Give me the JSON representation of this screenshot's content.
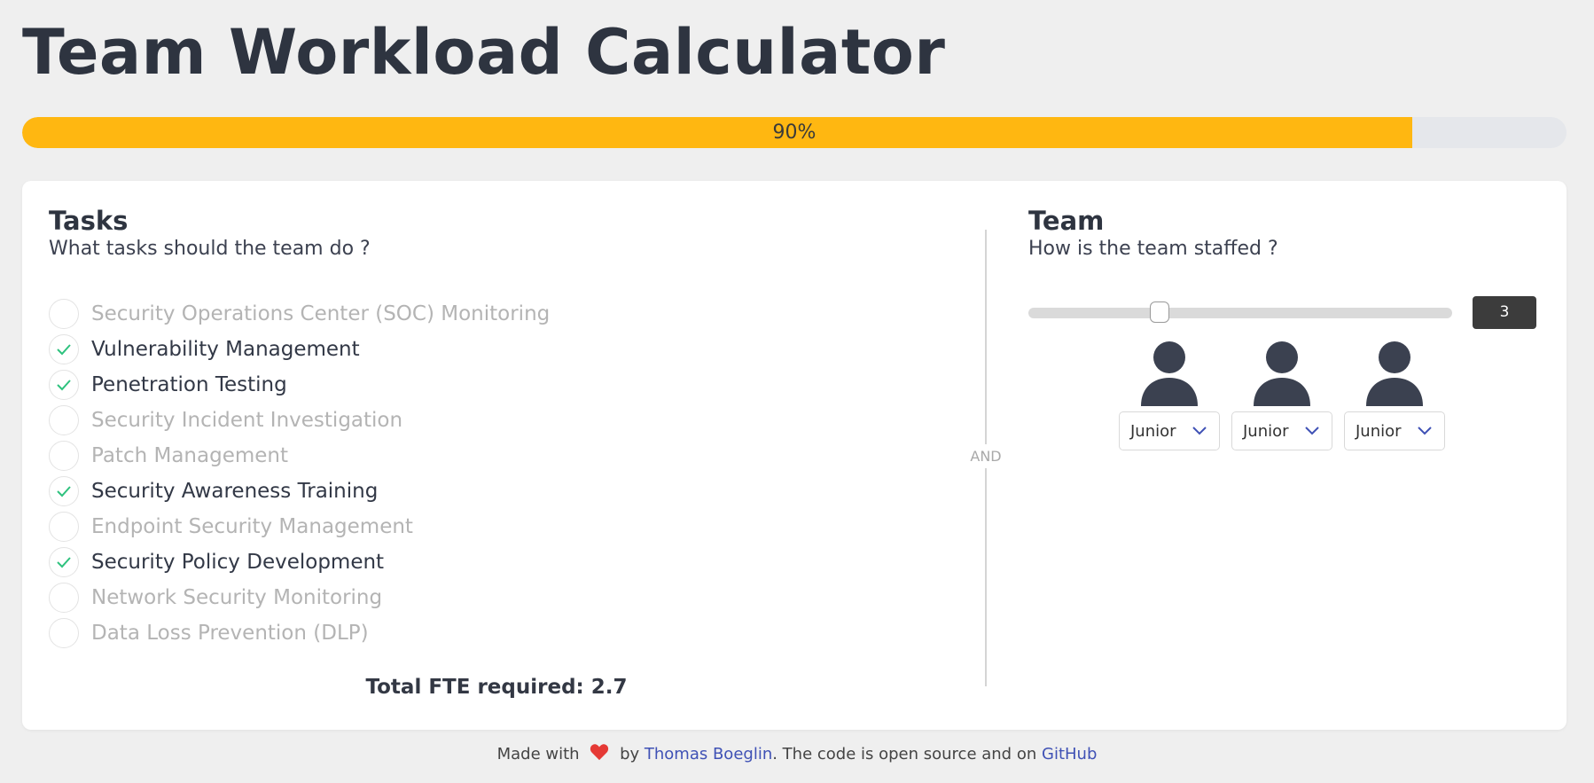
{
  "title": "Team Workload Calculator",
  "progress": {
    "percent": 90,
    "label": "90%",
    "color": "#ffb711"
  },
  "tasks_panel": {
    "heading": "Tasks",
    "subheading": "What tasks should the team do ?",
    "items": [
      {
        "label": "Security Operations Center (SOC) Monitoring",
        "checked": false
      },
      {
        "label": "Vulnerability Management",
        "checked": true
      },
      {
        "label": "Penetration Testing",
        "checked": true
      },
      {
        "label": "Security Incident Investigation",
        "checked": false
      },
      {
        "label": "Patch Management",
        "checked": false
      },
      {
        "label": "Security Awareness Training",
        "checked": true
      },
      {
        "label": "Endpoint Security Management",
        "checked": false
      },
      {
        "label": "Security Policy Development",
        "checked": true
      },
      {
        "label": "Network Security Monitoring",
        "checked": false
      },
      {
        "label": "Data Loss Prevention (DLP)",
        "checked": false
      }
    ],
    "total": "Total FTE required: 2.7"
  },
  "divider_label": "AND",
  "team_panel": {
    "heading": "Team",
    "subheading": "How is the team staffed ?",
    "slider": {
      "value": 3,
      "min": 0,
      "max": 10
    },
    "count_label": "3",
    "members": [
      {
        "icon": "person-icon",
        "level": "Junior"
      },
      {
        "icon": "person-icon",
        "level": "Junior"
      },
      {
        "icon": "person-icon",
        "level": "Junior"
      }
    ]
  },
  "footer": {
    "made_with": "Made with",
    "heart_icon": "heart-icon",
    "by": "by",
    "author": "Thomas Boeglin",
    "middle": ". The code is open source and on",
    "repo": "GitHub"
  },
  "colors": {
    "accent": "#ffb711",
    "check": "#2ec27e",
    "link": "#3f51b5",
    "heart": "#e53935"
  }
}
